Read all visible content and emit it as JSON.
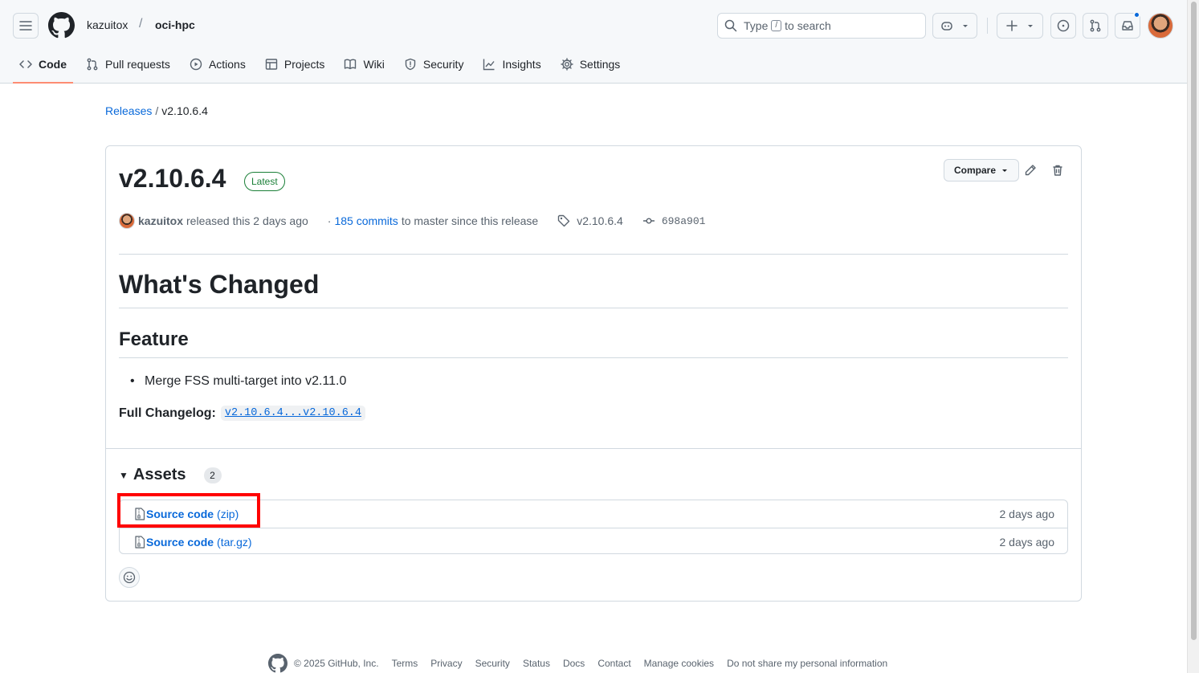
{
  "header": {
    "owner": "kazuitox",
    "separator": "/",
    "repo": "oci-hpc",
    "search_prefix": "Type",
    "search_key": "/",
    "search_suffix": "to search"
  },
  "tabs": [
    {
      "label": "Code",
      "icon": "code-icon",
      "active": true
    },
    {
      "label": "Pull requests",
      "icon": "git-pull-request-icon"
    },
    {
      "label": "Actions",
      "icon": "play-icon"
    },
    {
      "label": "Projects",
      "icon": "table-icon"
    },
    {
      "label": "Wiki",
      "icon": "book-icon"
    },
    {
      "label": "Security",
      "icon": "shield-icon"
    },
    {
      "label": "Insights",
      "icon": "graph-icon"
    },
    {
      "label": "Settings",
      "icon": "gear-icon"
    }
  ],
  "breadcrumb": {
    "releases": "Releases",
    "separator": "/",
    "current": "v2.10.6.4"
  },
  "release": {
    "title": "v2.10.6.4",
    "badge": "Latest",
    "compare_label": "Compare",
    "author": "kazuitox",
    "released_text": "released this 2 days ago",
    "dot": "·",
    "commits_link": "185 commits",
    "commits_suffix": "to master since this release",
    "tag": "v2.10.6.4",
    "commit_sha": "698a901"
  },
  "notes": {
    "heading": "What's Changed",
    "subheading": "Feature",
    "items": [
      "Merge FSS multi-target into v2.11.0"
    ],
    "changelog_label": "Full Changelog:",
    "changelog_link": "v2.10.6.4...v2.10.6.4"
  },
  "assets": {
    "title": "Assets",
    "count": "2",
    "items": [
      {
        "name": "Source code",
        "ext": "(zip)",
        "time": "2 days ago"
      },
      {
        "name": "Source code",
        "ext": "(tar.gz)",
        "time": "2 days ago"
      }
    ]
  },
  "footer": {
    "copyright": "© 2025 GitHub, Inc.",
    "links": [
      "Terms",
      "Privacy",
      "Security",
      "Status",
      "Docs",
      "Contact",
      "Manage cookies",
      "Do not share my personal information"
    ]
  },
  "colors": {
    "accent": "#0969da",
    "tab_underline": "#fd8c73",
    "latest_green": "#1a7f37",
    "highlight": "#ff0000",
    "notification": "#0969da"
  }
}
